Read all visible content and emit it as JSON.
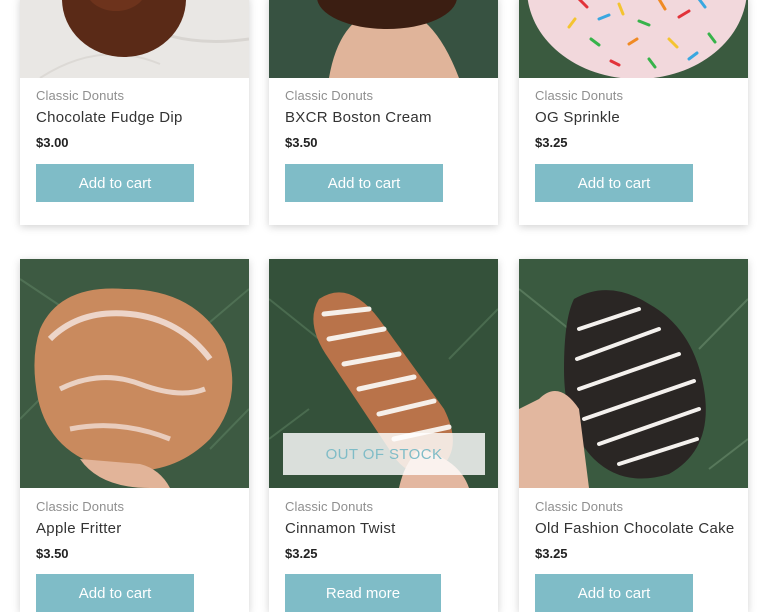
{
  "products": [
    {
      "category": "Classic Donuts",
      "name": "Chocolate Fudge Dip",
      "price": "$3.00",
      "button": "Add to cart"
    },
    {
      "category": "Classic Donuts",
      "name": "BXCR Boston Cream",
      "price": "$3.50",
      "button": "Add to cart"
    },
    {
      "category": "Classic Donuts",
      "name": "OG Sprinkle",
      "price": "$3.25",
      "button": "Add to cart"
    },
    {
      "category": "Classic Donuts",
      "name": "Apple Fritter",
      "price": "$3.50",
      "button": "Add to cart"
    },
    {
      "category": "Classic Donuts",
      "name": "Cinnamon Twist",
      "price": "$3.25",
      "button": "Read more",
      "badge": "OUT OF STOCK"
    },
    {
      "category": "Classic Donuts",
      "name": "Old Fashion Chocolate Cake",
      "price": "$3.25",
      "button": "Add to cart"
    }
  ],
  "colors": {
    "accent": "#7fbcc7"
  }
}
